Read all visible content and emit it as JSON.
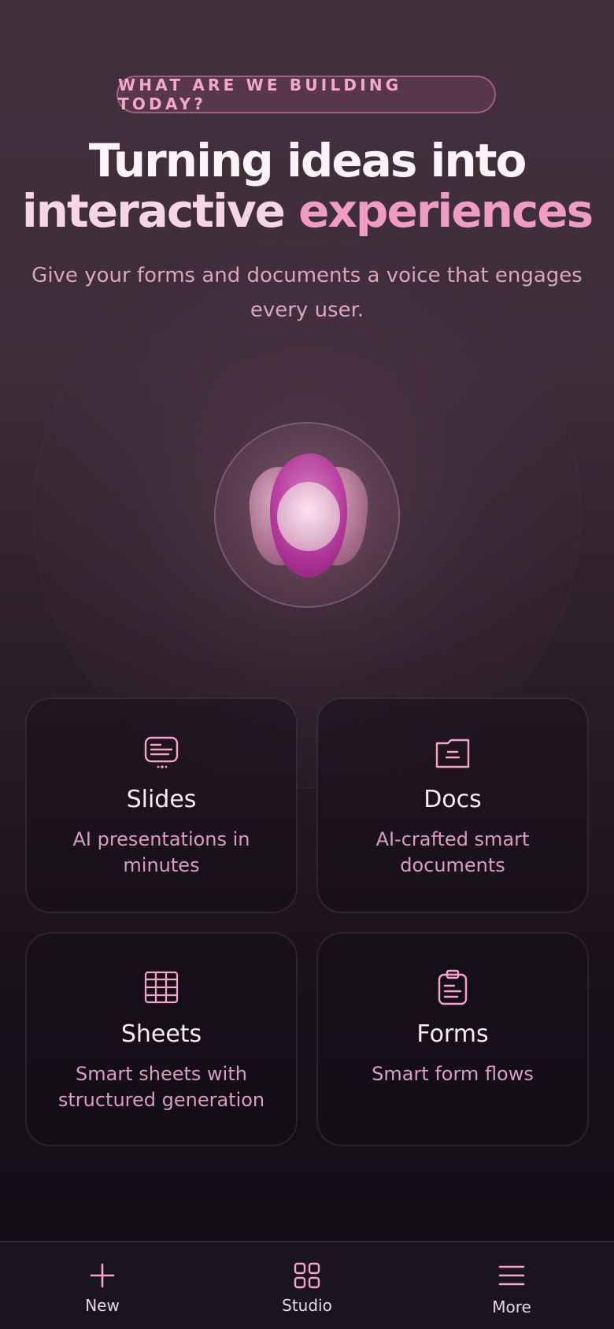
{
  "hero": {
    "eyebrow": "WHAT ARE WE BUILDING TODAY?",
    "headline_line1": "Turning ideas into",
    "headline_word_a": "interactive",
    "headline_word_b": "experiences",
    "subtitle": "Give your forms and documents a voice that engages every user."
  },
  "cards": [
    {
      "title": "Slides",
      "desc": "AI presentations in minutes",
      "icon": "slides-icon"
    },
    {
      "title": "Docs",
      "desc": "AI-crafted smart documents",
      "icon": "folder-icon"
    },
    {
      "title": "Sheets",
      "desc": "Smart sheets with structured generation",
      "icon": "grid-table-icon"
    },
    {
      "title": "Forms",
      "desc": "Smart form flows",
      "icon": "clipboard-icon"
    }
  ],
  "nav": [
    {
      "label": "New",
      "icon": "plus-icon"
    },
    {
      "label": "Studio",
      "icon": "apps-grid-icon"
    },
    {
      "label": "More",
      "icon": "menu-icon"
    }
  ],
  "colors": {
    "accent": "#ee9cc0",
    "accent_light": "#f6d6e4",
    "muted_pink": "#d79fb9",
    "bg_top": "#43303d",
    "bg_bottom": "#120c15"
  }
}
